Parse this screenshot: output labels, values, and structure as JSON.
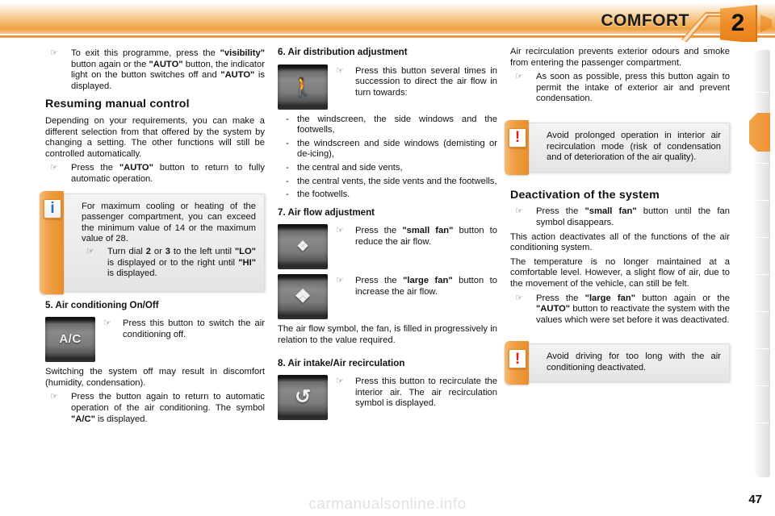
{
  "header": {
    "title": "COMFORT",
    "chapter_number": "2"
  },
  "page_number": "47",
  "watermark": "carmanualsonline.info",
  "icons": {
    "pointer": "☞",
    "info_badge": "i",
    "warning_badge": "!"
  },
  "column1": {
    "intro_bullet": {
      "pointer": "☞",
      "parts": [
        {
          "text": "To exit this programme, press the "
        },
        {
          "text": "\"visibility\"",
          "bold": true
        },
        {
          "text": " button again or the "
        },
        {
          "text": "\"AUTO\"",
          "bold": true
        },
        {
          "text": " button, the indicator light on the button switches off and "
        },
        {
          "text": "\"AUTO\"",
          "bold": true
        },
        {
          "text": " is displayed."
        }
      ]
    },
    "resuming_heading": "Resuming manual control",
    "resuming_body": "Depending on your requirements, you can make a different selection from that offered by the system by changing a setting. The other functions will still be controlled automatically.",
    "resuming_bullet": {
      "pointer": "☞",
      "parts": [
        {
          "text": "Press the "
        },
        {
          "text": "\"AUTO\"",
          "bold": true
        },
        {
          "text": " button to return to fully automatic operation."
        }
      ]
    },
    "info_box": {
      "badge": "i",
      "body": "For maximum cooling or heating of the passenger compartment, you can exceed the minimum value of 14 or the maximum value of 28.",
      "bullet": {
        "pointer": "☞",
        "parts": [
          {
            "text": "Turn dial "
          },
          {
            "text": "2",
            "bold": true
          },
          {
            "text": " or "
          },
          {
            "text": "3",
            "bold": true
          },
          {
            "text": " to the left until "
          },
          {
            "text": "\"LO\"",
            "bold": true
          },
          {
            "text": " is displayed or to the right until "
          },
          {
            "text": "\"HI\"",
            "bold": true
          },
          {
            "text": " is displayed."
          }
        ]
      }
    },
    "section5": {
      "heading": "5. Air conditioning On/Off",
      "button_glyph": "A/C",
      "bullet": {
        "pointer": "☞",
        "parts": [
          {
            "text": "Press this button to switch the air conditioning off."
          }
        ]
      },
      "body": "Switching the system off may result in discomfort (humidity, condensation).",
      "bullet2": {
        "pointer": "☞",
        "parts": [
          {
            "text": "Press the button again to return to automatic operation of the air conditioning. The symbol "
          },
          {
            "text": "\"A/C\"",
            "bold": true
          },
          {
            "text": " is displayed."
          }
        ]
      }
    }
  },
  "column2": {
    "section6": {
      "heading": "6. Air distribution adjustment",
      "button_glyph": "air-distribution-symbol",
      "bullet": {
        "pointer": "☞",
        "parts": [
          {
            "text": "Press this button several times in succession to direct the air flow in turn towards:"
          }
        ]
      },
      "list": [
        "the windscreen, the side windows and the footwells,",
        "the windscreen and side windows (demisting or de-icing),",
        "the central and side vents,",
        "the central vents, the side vents and the footwells,",
        "the footwells."
      ]
    },
    "section7": {
      "heading": "7. Air flow adjustment",
      "small_fan_glyph": "small-fan-symbol",
      "bullet_small": {
        "pointer": "☞",
        "parts": [
          {
            "text": "Press the "
          },
          {
            "text": "\"small fan\"",
            "bold": true
          },
          {
            "text": " button to reduce the air flow."
          }
        ]
      },
      "large_fan_glyph": "large-fan-symbol",
      "bullet_large": {
        "pointer": "☞",
        "parts": [
          {
            "text": "Press the "
          },
          {
            "text": "\"large fan\"",
            "bold": true
          },
          {
            "text": " button to increase the air flow."
          }
        ]
      },
      "body": "The air flow symbol, the fan, is filled in progressively in relation to the value required."
    },
    "section8": {
      "heading": "8. Air intake/Air recirculation",
      "button_glyph": "recirculation-symbol",
      "bullet": {
        "pointer": "☞",
        "parts": [
          {
            "text": "Press this button to recirculate the interior air. The air recirculation symbol is displayed."
          }
        ]
      }
    }
  },
  "column3": {
    "recirc_body": "Air recirculation prevents exterior odours and smoke from entering the passenger compartment.",
    "recirc_bullet": {
      "pointer": "☞",
      "parts": [
        {
          "text": "As soon as possible, press this button again to permit the intake of exterior air and prevent condensation."
        }
      ]
    },
    "warning_box1": {
      "badge": "!",
      "body": "Avoid prolonged operation in interior air recirculation mode (risk of condensation and of deterioration of the air quality)."
    },
    "deactivation": {
      "heading": "Deactivation of the system",
      "bullet1": {
        "pointer": "☞",
        "parts": [
          {
            "text": "Press the "
          },
          {
            "text": "\"small fan\"",
            "bold": true
          },
          {
            "text": " button until the fan symbol disappears."
          }
        ]
      },
      "body1": "This action deactivates all of the functions of the air conditioning system.",
      "body2": "The temperature is no longer maintained at a comfortable level. However, a slight flow of air, due to the movement of the vehicle, can still be felt.",
      "bullet2": {
        "pointer": "☞",
        "parts": [
          {
            "text": "Press the "
          },
          {
            "text": "\"large fan\"",
            "bold": true
          },
          {
            "text": " button again or the "
          },
          {
            "text": "\"AUTO\"",
            "bold": true
          },
          {
            "text": " button to reactivate the system with the values which were set before it was deactivated."
          }
        ]
      }
    },
    "warning_box2": {
      "badge": "!",
      "body": "Avoid driving for too long with the air conditioning deactivated."
    }
  },
  "colors": {
    "accent_orange": "#ef9233",
    "warning_red": "#d81f1f",
    "info_blue": "#2a6fb5",
    "text": "#111111"
  }
}
